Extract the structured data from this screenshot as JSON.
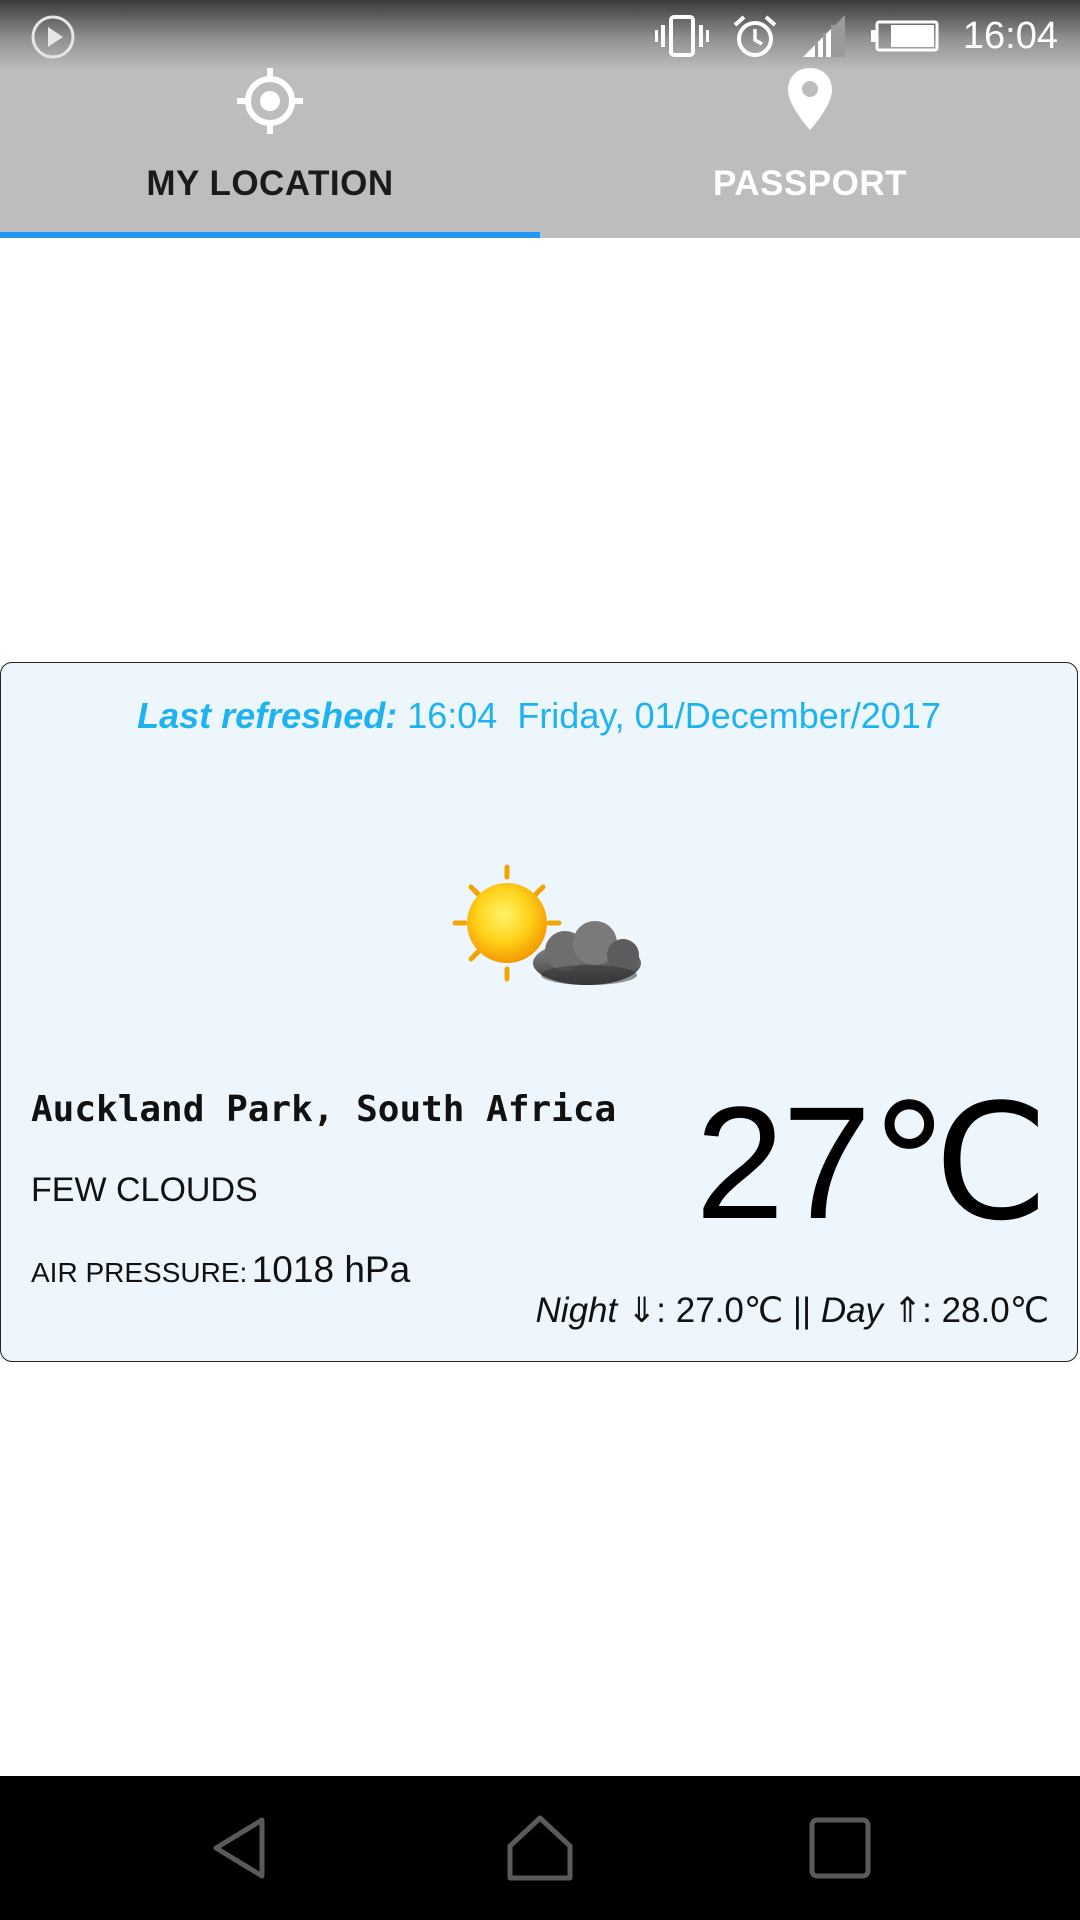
{
  "status_bar": {
    "time": "16:04",
    "icons": [
      "play-icon",
      "vibrate-icon",
      "alarm-icon",
      "signal-icon",
      "battery-icon"
    ]
  },
  "tabs": [
    {
      "label": "MY LOCATION",
      "icon": "crosshair-icon",
      "active": true
    },
    {
      "label": "PASSPORT",
      "icon": "map-pin-icon",
      "active": false
    }
  ],
  "weather": {
    "refreshed_label": "Last refreshed:",
    "refreshed_time": "16:04",
    "refreshed_date": "Friday, 01/December/2017",
    "icon": "partly-cloudy-icon",
    "location": "Auckland Park, South Africa",
    "description": "FEW CLOUDS",
    "pressure_label": "AIR PRESSURE:",
    "pressure_value": "1018 hPa",
    "temperature": "27℃",
    "night_label": "Night",
    "night_arrow": "⇓",
    "night_value": ": 27.0℃",
    "separator": " || ",
    "day_label": "Day",
    "day_arrow": "⇑",
    "day_value": ": 28.0℃"
  },
  "colors": {
    "accent": "#2196f3",
    "refreshed_text": "#1eb3f0",
    "card_background": "#eef6fd",
    "toolbar": "#bdbdbd"
  },
  "nav_bar": [
    "back-icon",
    "home-icon",
    "recents-icon"
  ]
}
